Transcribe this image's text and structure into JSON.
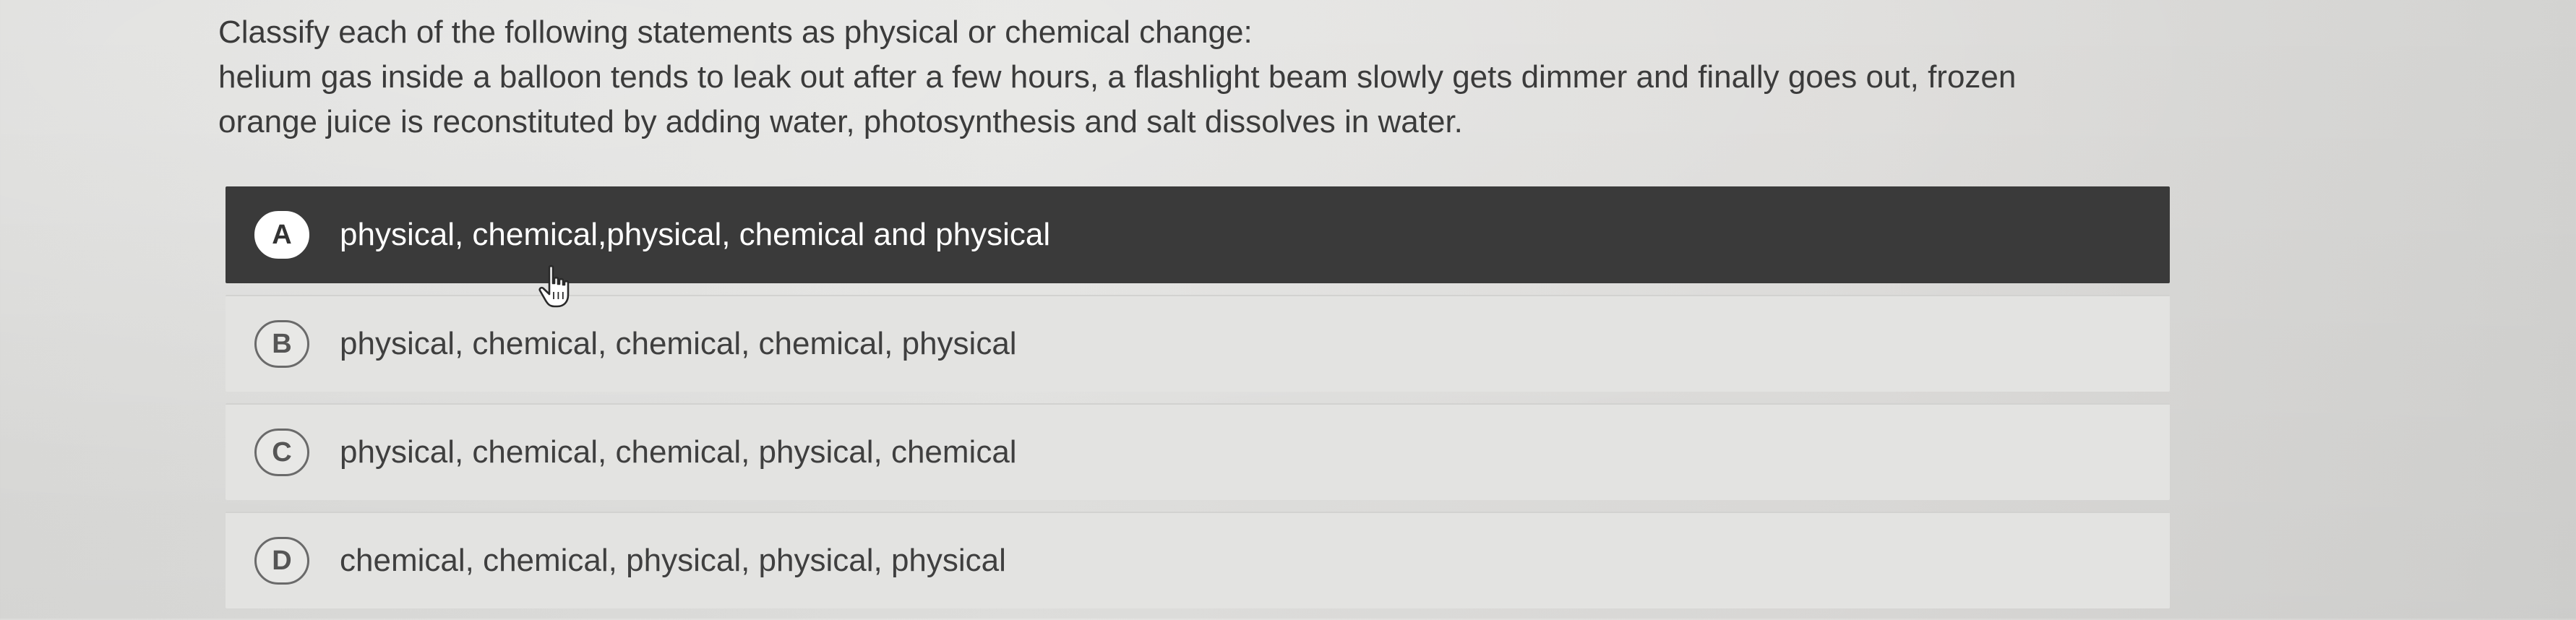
{
  "question": {
    "line1": "Classify each of the following statements as physical or chemical change:",
    "line2": "helium gas inside a balloon tends to leak out after a few hours, a flashlight beam slowly gets dimmer and finally goes out, frozen",
    "line3": "orange juice is reconstituted by adding water, photosynthesis and salt dissolves in water."
  },
  "options": [
    {
      "letter": "A",
      "text": "physical, chemical,physical, chemical and physical",
      "selected": true
    },
    {
      "letter": "B",
      "text": "physical, chemical, chemical, chemical, physical",
      "selected": false
    },
    {
      "letter": "C",
      "text": "physical, chemical, chemical, physical, chemical",
      "selected": false
    },
    {
      "letter": "D",
      "text": "chemical, chemical, physical, physical, physical",
      "selected": false
    }
  ],
  "colors": {
    "selected_background": "#3a3a3a",
    "option_background": "#e3e3e1",
    "text": "#3b3b3b"
  },
  "icons": {
    "cursor": "hand-pointer-icon"
  }
}
